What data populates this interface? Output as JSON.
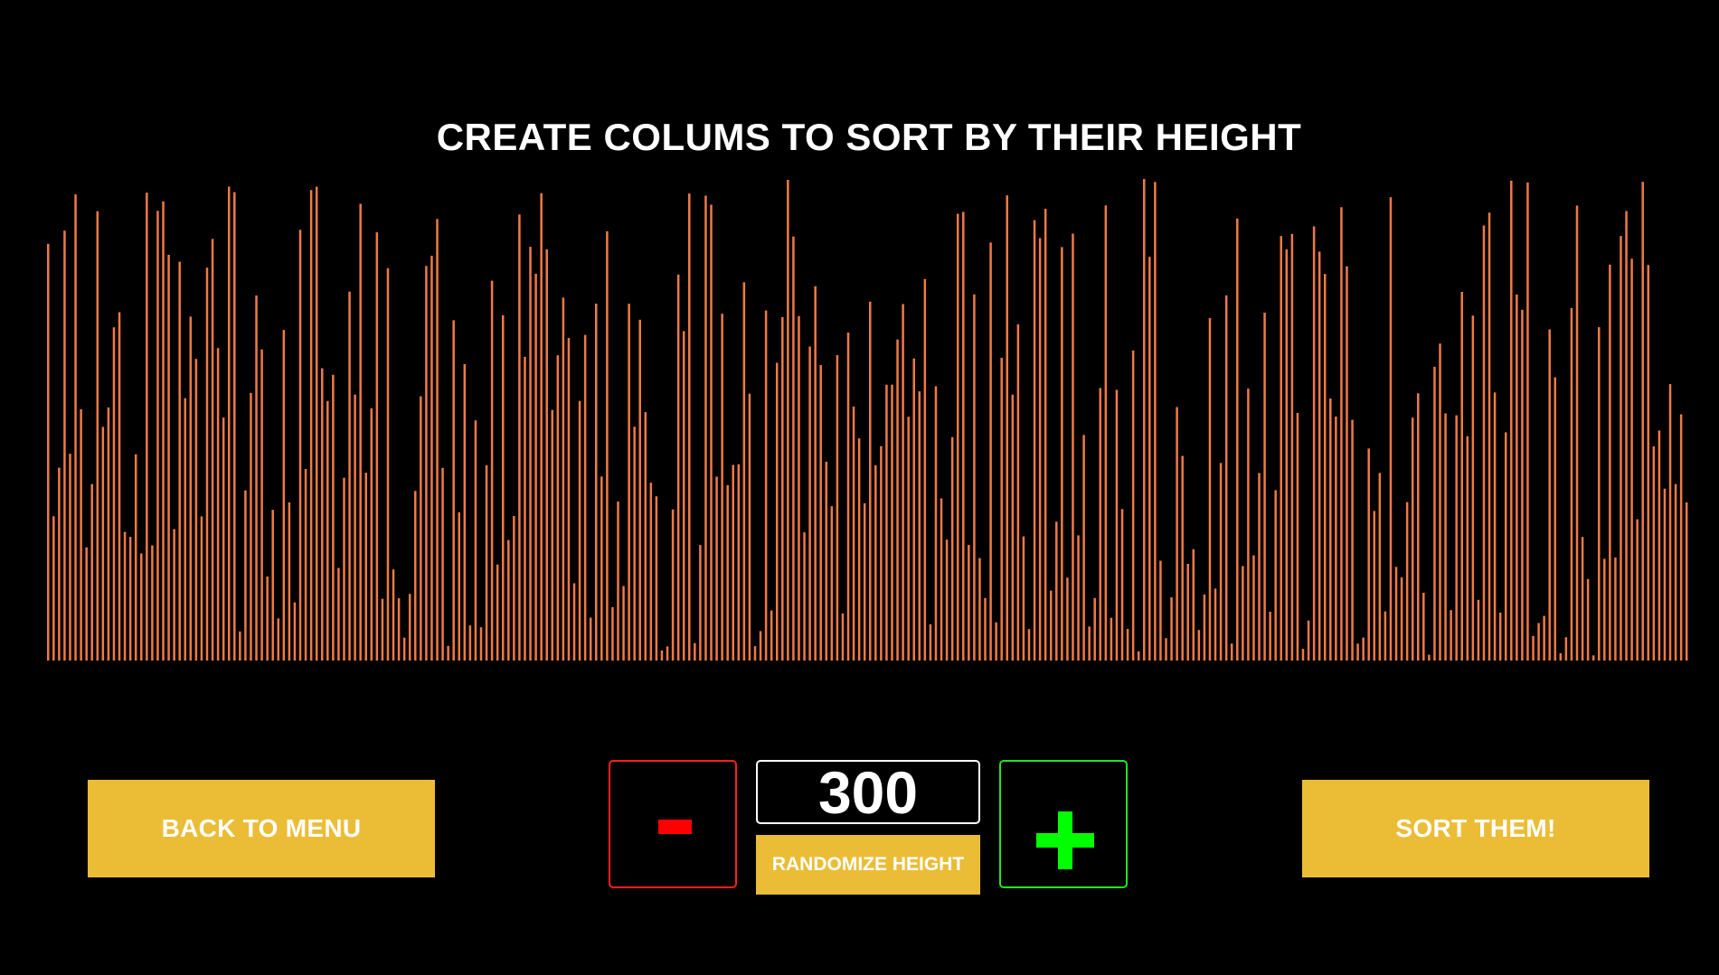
{
  "title": "CREATE COLUMS TO SORT BY THEIR HEIGHT",
  "buttons": {
    "back": "BACK TO MENU",
    "sort": "SORT THEM!",
    "randomize": "RANDOMIZE HEIGHT",
    "decrement": "-",
    "increment": "+"
  },
  "column_count": "300",
  "colors": {
    "background": "#000000",
    "column": "#f07a45",
    "button": "#ebbd37",
    "decrement_border": "#ff1e1e",
    "decrement_icon": "#ff0000",
    "increment_border": "#22e622",
    "increment_icon": "#00ff00"
  },
  "icons": {
    "decrement": "minus-icon",
    "increment": "plus-icon"
  }
}
